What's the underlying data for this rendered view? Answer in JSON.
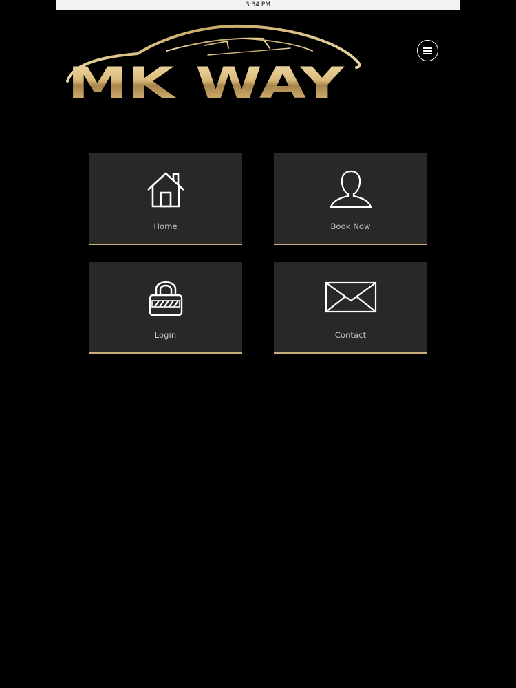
{
  "status_bar": {
    "time": "3:34 PM"
  },
  "brand": {
    "name": "MK WAY",
    "gold": "#c9ad7a"
  },
  "menu": {
    "icon": "hamburger-menu-icon"
  },
  "tiles": [
    {
      "label": "Home",
      "icon": "home-icon"
    },
    {
      "label": "Book Now",
      "icon": "person-icon"
    },
    {
      "label": "Login",
      "icon": "lock-icon"
    },
    {
      "label": "Contact",
      "icon": "envelope-icon"
    }
  ],
  "colors": {
    "background": "#000000",
    "tile": "#292828",
    "accent": "#c9ad7a",
    "label": "#c4c4c4"
  }
}
